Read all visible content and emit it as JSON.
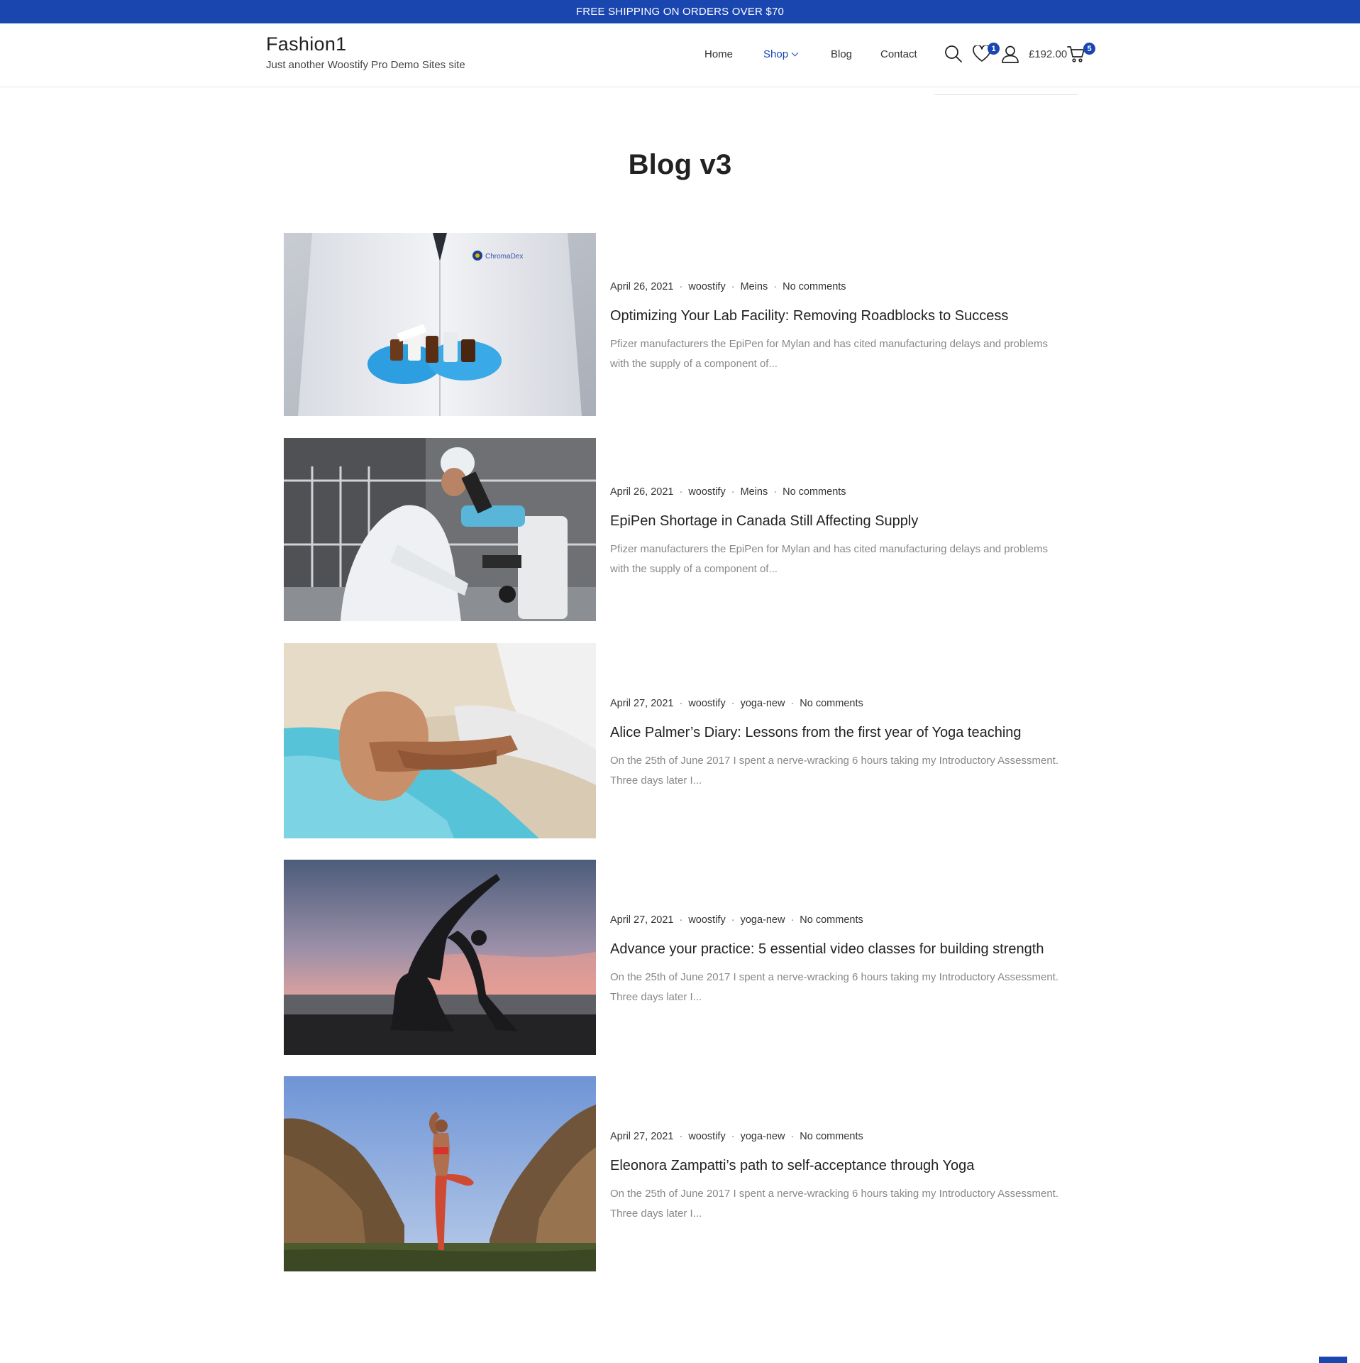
{
  "topbar": {
    "text": "FREE SHIPPING ON ORDERS OVER $70"
  },
  "header": {
    "site_title": "Fashion1",
    "tagline": "Just another Woostify Pro Demo Sites site",
    "nav": [
      {
        "label": "Home"
      },
      {
        "label": "Shop"
      },
      {
        "label": "Blog"
      },
      {
        "label": "Contact"
      }
    ],
    "wishlist_count": "1",
    "cart_total": "£192.00",
    "cart_count": "5"
  },
  "page": {
    "title": "Blog v3"
  },
  "posts": [
    {
      "date": "April 26, 2021",
      "author": "woostify",
      "category": "Meins",
      "comments": "No comments",
      "title": "Optimizing Your Lab Facility: Removing Roadblocks to Success",
      "excerpt_line1": "Pfizer manufacturers the EpiPen for Mylan and has cited manufacturing delays and problems",
      "excerpt_line2": "with the supply of a component of...",
      "thumb_logo": "ChromaDex"
    },
    {
      "date": "April 26, 2021",
      "author": "woostify",
      "category": "Meins",
      "comments": "No comments",
      "title": "EpiPen Shortage in Canada Still Affecting Supply",
      "excerpt_line1": "Pfizer manufacturers the EpiPen for Mylan and has cited manufacturing delays and problems",
      "excerpt_line2": "with the supply of a component of..."
    },
    {
      "date": "April 27, 2021",
      "author": "woostify",
      "category": "yoga-new",
      "comments": "No comments",
      "title": "Alice Palmer’s Diary: Lessons from the first year of Yoga teaching",
      "excerpt_line1": "On the 25th of June 2017 I spent a nerve-wracking 6 hours taking my Introductory Assessment.",
      "excerpt_line2": "Three days later I..."
    },
    {
      "date": "April 27, 2021",
      "author": "woostify",
      "category": "yoga-new",
      "comments": "No comments",
      "title": "Advance your practice: 5 essential video classes for building strength",
      "excerpt_line1": "On the 25th of June 2017 I spent a nerve-wracking 6 hours taking my Introductory Assessment.",
      "excerpt_line2": "Three days later I..."
    },
    {
      "date": "April 27, 2021",
      "author": "woostify",
      "category": "yoga-new",
      "comments": "No comments",
      "title": "Eleonora Zampatti’s path to self-acceptance through Yoga",
      "excerpt_line1": "On the 25th of June 2017 I spent a nerve-wracking 6 hours taking my Introductory Assessment.",
      "excerpt_line2": "Three days later I..."
    }
  ],
  "colors": {
    "accent": "#1a46b0"
  }
}
